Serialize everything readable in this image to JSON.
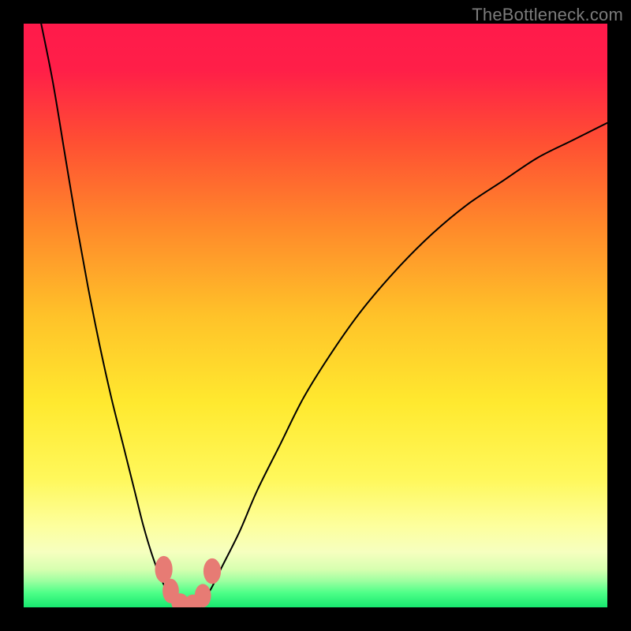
{
  "attribution": "TheBottleneck.com",
  "chart_data": {
    "type": "line",
    "title": "",
    "xlabel": "",
    "ylabel": "",
    "xlim": [
      0,
      100
    ],
    "ylim": [
      0,
      100
    ],
    "gradient_stops": [
      {
        "offset": 0.0,
        "color": "#ff1a4b"
      },
      {
        "offset": 0.08,
        "color": "#ff1f48"
      },
      {
        "offset": 0.2,
        "color": "#ff4e33"
      },
      {
        "offset": 0.35,
        "color": "#ff8a2a"
      },
      {
        "offset": 0.5,
        "color": "#ffc229"
      },
      {
        "offset": 0.65,
        "color": "#ffe92f"
      },
      {
        "offset": 0.78,
        "color": "#fff85b"
      },
      {
        "offset": 0.86,
        "color": "#fdff9d"
      },
      {
        "offset": 0.905,
        "color": "#f6ffbf"
      },
      {
        "offset": 0.935,
        "color": "#d7ffb0"
      },
      {
        "offset": 0.955,
        "color": "#9cffa0"
      },
      {
        "offset": 0.975,
        "color": "#4eff88"
      },
      {
        "offset": 1.0,
        "color": "#17e86f"
      }
    ],
    "series": [
      {
        "name": "left-arm",
        "x": [
          3,
          5,
          7,
          9,
          11,
          13,
          15,
          17,
          19,
          20.5,
          22,
          23.5,
          25,
          26,
          27
        ],
        "values": [
          100,
          90,
          78,
          66,
          55,
          45,
          36,
          28,
          20,
          14,
          9,
          5,
          2,
          0.8,
          0
        ]
      },
      {
        "name": "right-arm",
        "x": [
          30,
          32,
          34,
          37,
          40,
          44,
          48,
          53,
          58,
          64,
          70,
          76,
          82,
          88,
          94,
          100
        ],
        "values": [
          0,
          3,
          7,
          13,
          20,
          28,
          36,
          44,
          51,
          58,
          64,
          69,
          73,
          77,
          80,
          83
        ]
      }
    ],
    "valley_floor": {
      "x_start": 27,
      "x_end": 30,
      "y": 0
    },
    "markers": [
      {
        "x": 24.0,
        "y": 6.5,
        "rx": 1.5,
        "ry": 2.3
      },
      {
        "x": 25.2,
        "y": 2.8,
        "rx": 1.4,
        "ry": 2.1
      },
      {
        "x": 26.8,
        "y": 0.8,
        "rx": 1.5,
        "ry": 1.6
      },
      {
        "x": 29.0,
        "y": 0.6,
        "rx": 1.5,
        "ry": 1.6
      },
      {
        "x": 30.7,
        "y": 2.0,
        "rx": 1.4,
        "ry": 2.0
      },
      {
        "x": 32.3,
        "y": 6.2,
        "rx": 1.5,
        "ry": 2.2
      }
    ],
    "marker_color": "#e77b74"
  }
}
